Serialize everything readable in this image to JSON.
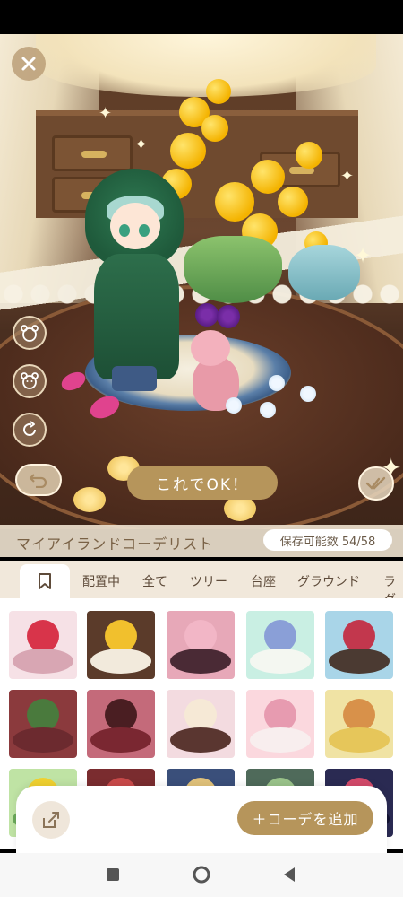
{
  "scene": {
    "confirm_label": "これでOK！"
  },
  "title_bar": {
    "title": "マイアイランドコーデリスト",
    "save_count": "保存可能数 54/58"
  },
  "tabs": [
    {
      "label": "配置中"
    },
    {
      "label": "全て"
    },
    {
      "label": "ツリー"
    },
    {
      "label": "台座"
    },
    {
      "label": "グラウンド"
    },
    {
      "label": "ラグ"
    }
  ],
  "grid": {
    "rows": [
      [
        {
          "bg": "#f6e1e6",
          "floor": "#d8a6b3",
          "accent": "#d8344a"
        },
        {
          "bg": "#5b3b2a",
          "floor": "#f2eadc",
          "accent": "#f1c02d"
        },
        {
          "bg": "#e7a8b8",
          "floor": "#4a2a35",
          "accent": "#f2b6c6"
        },
        {
          "bg": "#c9efe3",
          "floor": "#f4f7f1",
          "accent": "#8a9fd7"
        },
        {
          "bg": "#a9d5e8",
          "floor": "#4b3a32",
          "accent": "#c2374d"
        }
      ],
      [
        {
          "bg": "#8b3a3d",
          "floor": "#6c2a2f",
          "accent": "#4a7a3d"
        },
        {
          "bg": "#c46a7a",
          "floor": "#7a2731",
          "accent": "#4a1e22"
        },
        {
          "bg": "#f3dbe0",
          "floor": "#5a3630",
          "accent": "#f6e9d6"
        },
        {
          "bg": "#fbd8de",
          "floor": "#f8eeee",
          "accent": "#e79bb0"
        },
        {
          "bg": "#f0e3a4",
          "floor": "#e6c65a",
          "accent": "#d8914a"
        }
      ],
      [
        {
          "bg": "#bfe3a4",
          "floor": "#6aa85a",
          "accent": "#f0d130"
        },
        {
          "bg": "#7a2c2f",
          "floor": "#3a1a1c",
          "accent": "#c94a4a"
        },
        {
          "bg": "#3a4f7a",
          "floor": "#24304f",
          "accent": "#e1c27a"
        },
        {
          "bg": "#4f6a5a",
          "floor": "#2e3f33",
          "accent": "#9ac38a"
        },
        {
          "bg": "#2a2a52",
          "floor": "#141434",
          "accent": "#d34a6a"
        }
      ]
    ]
  },
  "bottom": {
    "add_label": "＋コーデを追加"
  },
  "colors": {
    "accent": "#b6955b",
    "tab_bg": "#f1e8db"
  }
}
